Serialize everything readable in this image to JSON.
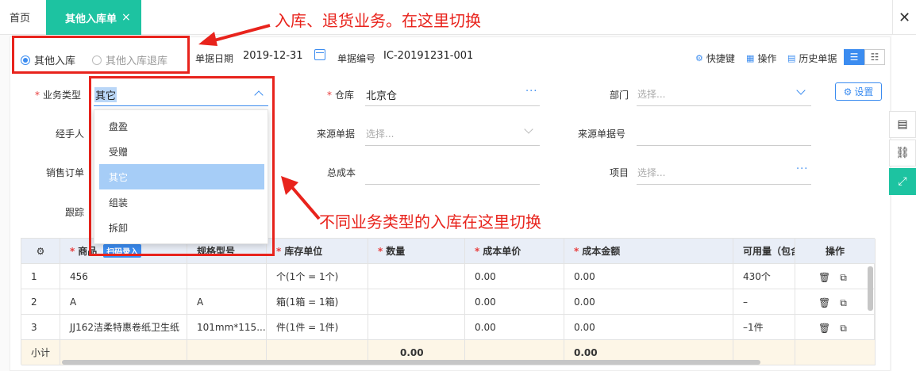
{
  "tabs": {
    "home": "首页",
    "active": "其他入库单",
    "active_close": "×",
    "window_close": "✕"
  },
  "header": {
    "radio_in": "其他入库",
    "radio_return": "其他入库退库",
    "date_label": "单据日期",
    "date_value": "2019-12-31",
    "no_label": "单据编号",
    "no_value": "IC-20191231-001",
    "shortcut": "快捷键",
    "operate": "操作",
    "history": "历史单据",
    "view_list_icon": "list-view-icon",
    "view_card_icon": "card-view-icon"
  },
  "form": {
    "biz_type_label": "业务类型",
    "biz_type_value": "其它",
    "warehouse_label": "仓库",
    "warehouse_value": "北京仓",
    "dept_label": "部门",
    "dept_placeholder": "选择...",
    "settings": "设置",
    "handler_label": "经手人",
    "source_label": "来源单据",
    "source_placeholder": "选择...",
    "source_no_label": "来源单据号",
    "sales_order_label": "销售订单",
    "total_cost_label": "总成本",
    "project_label": "项目",
    "project_placeholder": "选择...",
    "track_label": "跟踪",
    "more": "···"
  },
  "dropdown": {
    "options": [
      "盘盈",
      "受赠",
      "其它",
      "组装",
      "拆卸"
    ],
    "selected": "其它"
  },
  "table": {
    "headers": {
      "product": "商品",
      "scan": "扫码录入",
      "spec": "规格型号",
      "unit": "库存单位",
      "qty": "数量",
      "unit_cost": "成本单价",
      "amount": "成本金额",
      "available": "可用量（包含",
      "ops": "操作"
    },
    "rows": [
      {
        "no": "1",
        "product": "456",
        "spec": "",
        "unit": "个(1个 = 1个)",
        "qty": "",
        "unit_cost": "0.00",
        "amount": "0.00",
        "available": "430个"
      },
      {
        "no": "2",
        "product": "A",
        "spec": "A",
        "unit": "箱(1箱 = 1箱)",
        "qty": "",
        "unit_cost": "0.00",
        "amount": "0.00",
        "available": "–"
      },
      {
        "no": "3",
        "product": "JJ162洁柔特惠卷纸卫生纸",
        "spec": "101mm*115...",
        "unit": "件(1件 = 1件)",
        "qty": "",
        "unit_cost": "0.00",
        "amount": "0.00",
        "available": "–1件"
      }
    ],
    "subtotal_label": "小计",
    "subtotal_qty": "0.00",
    "subtotal_amount": "0.00"
  },
  "annotations": {
    "top_note": "入库、退货业务。在这里切换",
    "mid_note": "不同业务类型的入库在这里切换",
    "color": "#e8231c"
  },
  "colors": {
    "accent": "#1dc3a1",
    "blue": "#3b8cf0"
  }
}
